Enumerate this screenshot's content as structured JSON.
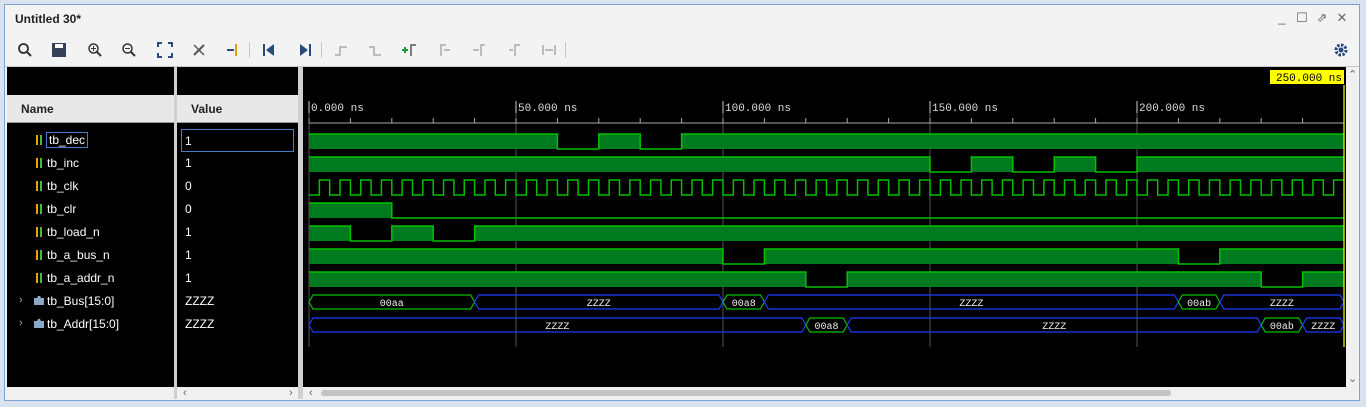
{
  "window": {
    "title": "Untitled 30*"
  },
  "toolbar": {
    "icons": [
      "search-icon",
      "save-icon",
      "zoom-in-icon",
      "zoom-out-icon",
      "zoom-fit-icon",
      "cursor-snap-icon",
      "add-marker-icon",
      "go-to-start-icon",
      "go-to-end-icon",
      "previous-transition-icon",
      "next-transition-icon",
      "add-marker-plus-icon",
      "go-to-previous-marker-icon",
      "go-to-next-marker-icon",
      "delete-marker-icon",
      "swap-cursors-icon",
      "settings-gear-icon"
    ]
  },
  "panel": {
    "name_header": "Name",
    "value_header": "Value",
    "cursor_time": "250.000 ns"
  },
  "signals": [
    {
      "name": "tb_dec",
      "value": "1",
      "type": "bit",
      "selected": true
    },
    {
      "name": "tb_inc",
      "value": "1",
      "type": "bit"
    },
    {
      "name": "tb_clk",
      "value": "0",
      "type": "bit"
    },
    {
      "name": "tb_clr",
      "value": "0",
      "type": "bit"
    },
    {
      "name": "tb_load_n",
      "value": "1",
      "type": "bit"
    },
    {
      "name": "tb_a_bus_n",
      "value": "1",
      "type": "bit"
    },
    {
      "name": "tb_a_addr_n",
      "value": "1",
      "type": "bit"
    },
    {
      "name": "tb_Bus[15:0]",
      "value": "ZZZZ",
      "type": "bus"
    },
    {
      "name": "tb_Addr[15:0]",
      "value": "ZZZZ",
      "type": "bus"
    }
  ],
  "timeline": {
    "range_ns": [
      0,
      250
    ],
    "ticks": [
      {
        "t": 0,
        "label": "0.000 ns"
      },
      {
        "t": 50,
        "label": "50.000 ns"
      },
      {
        "t": 100,
        "label": "100.000 ns"
      },
      {
        "t": 150,
        "label": "150.000 ns"
      },
      {
        "t": 200,
        "label": "200.000 ns"
      }
    ]
  },
  "waves": {
    "tb_dec": [
      [
        0,
        1
      ],
      [
        60,
        0
      ],
      [
        70,
        1
      ],
      [
        80,
        0
      ],
      [
        90,
        1
      ]
    ],
    "tb_inc": [
      [
        0,
        1
      ],
      [
        150,
        0
      ],
      [
        160,
        1
      ],
      [
        170,
        0
      ],
      [
        180,
        1
      ],
      [
        190,
        0
      ],
      [
        200,
        1
      ]
    ],
    "tb_clk_period_ns": 5,
    "tb_clr": [
      [
        0,
        1
      ],
      [
        20,
        0
      ]
    ],
    "tb_load_n": [
      [
        0,
        1
      ],
      [
        10,
        0
      ],
      [
        20,
        1
      ],
      [
        30,
        0
      ],
      [
        40,
        1
      ]
    ],
    "tb_a_bus_n": [
      [
        0,
        1
      ],
      [
        100,
        0
      ],
      [
        110,
        1
      ],
      [
        210,
        0
      ],
      [
        220,
        1
      ]
    ],
    "tb_a_addr_n": [
      [
        0,
        1
      ],
      [
        120,
        0
      ],
      [
        130,
        1
      ],
      [
        230,
        0
      ],
      [
        240,
        1
      ]
    ],
    "tb_Bus": [
      {
        "from": 0,
        "to": 40,
        "label": "00aa"
      },
      {
        "from": 40,
        "to": 100,
        "label": "ZZZZ"
      },
      {
        "from": 100,
        "to": 110,
        "label": "00a8"
      },
      {
        "from": 110,
        "to": 210,
        "label": "ZZZZ"
      },
      {
        "from": 210,
        "to": 220,
        "label": "00ab"
      },
      {
        "from": 220,
        "to": 250,
        "label": "ZZZZ"
      }
    ],
    "tb_Addr": [
      {
        "from": 0,
        "to": 120,
        "label": "ZZZZ"
      },
      {
        "from": 120,
        "to": 130,
        "label": "00a8"
      },
      {
        "from": 130,
        "to": 230,
        "label": "ZZZZ"
      },
      {
        "from": 230,
        "to": 240,
        "label": "00ab"
      },
      {
        "from": 240,
        "to": 250,
        "label": "ZZZZ"
      }
    ]
  },
  "colors": {
    "wave": "#00c000",
    "wave_fill": "#007a1e",
    "bus": "#1a3cff",
    "grid": "#3a3a3a",
    "cursor": "#ffff00",
    "label_bg": "#ffff00"
  }
}
